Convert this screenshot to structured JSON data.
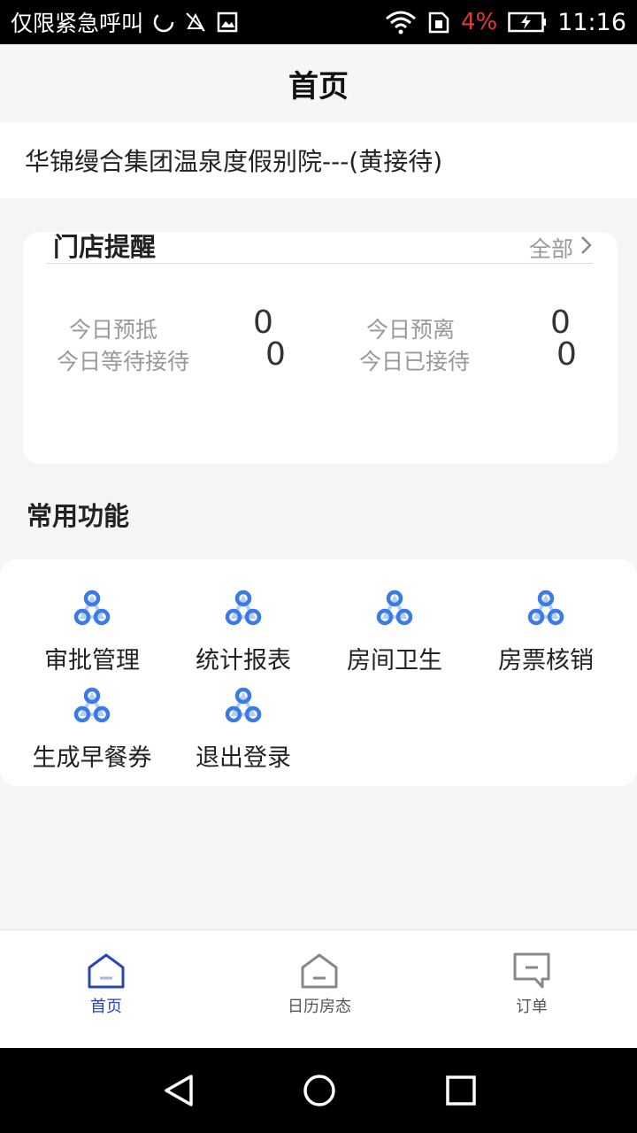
{
  "status_bar": {
    "carrier": "仅限紧急呼叫",
    "battery": "4%",
    "time": "11:16"
  },
  "header": {
    "title": "首页"
  },
  "hotel": {
    "name": "华锦缦合集团温泉度假别院---(黄接待)"
  },
  "reminder": {
    "title": "门店提醒",
    "more": "全部",
    "stats": [
      {
        "label": "今日预抵",
        "value": "0"
      },
      {
        "label": "今日预离",
        "value": "0"
      },
      {
        "label": "今日等待接待",
        "value": "0"
      },
      {
        "label": "今日已接待",
        "value": "0"
      }
    ]
  },
  "functions": {
    "title": "常用功能",
    "items": [
      {
        "label": "审批管理"
      },
      {
        "label": "统计报表"
      },
      {
        "label": "房间卫生"
      },
      {
        "label": "房票核销"
      },
      {
        "label": "生成早餐券"
      },
      {
        "label": "退出登录"
      }
    ]
  },
  "tabbar": {
    "tabs": [
      {
        "label": "首页",
        "icon": "home-icon",
        "active": true
      },
      {
        "label": "日历房态",
        "icon": "home-outline-icon",
        "active": false
      },
      {
        "label": "订单",
        "icon": "chat-icon",
        "active": false
      }
    ]
  },
  "colors": {
    "accent": "#2846b8",
    "icon_blue": "#3a7be8",
    "battery_low": "#e53935"
  }
}
